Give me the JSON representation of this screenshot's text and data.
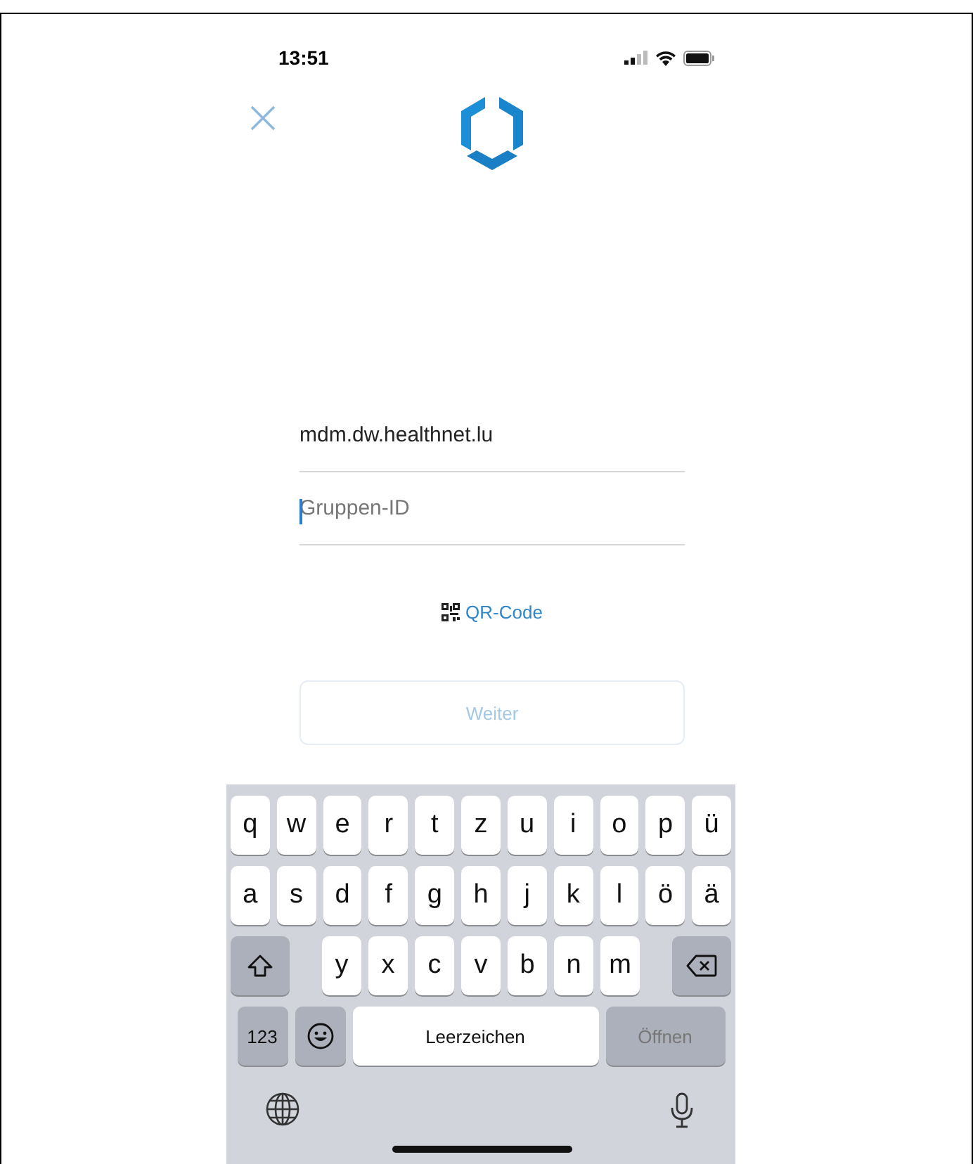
{
  "status_bar": {
    "time": "13:51"
  },
  "fields": [
    {
      "value": "mdm.dw.healthnet.lu",
      "focused": false
    },
    {
      "placeholder": "Gruppen-ID",
      "focused": true
    }
  ],
  "qr_link": {
    "label": "QR-Code"
  },
  "continue_button": {
    "label": "Weiter",
    "disabled": true
  },
  "keyboard": {
    "rows": [
      {
        "keys": [
          {
            "kind": "letter",
            "label": "q"
          },
          {
            "kind": "letter",
            "label": "w"
          },
          {
            "kind": "letter",
            "label": "e"
          },
          {
            "kind": "letter",
            "label": "r"
          },
          {
            "kind": "letter",
            "label": "t"
          },
          {
            "kind": "letter",
            "label": "z"
          },
          {
            "kind": "letter",
            "label": "u"
          },
          {
            "kind": "letter",
            "label": "i"
          },
          {
            "kind": "letter",
            "label": "o"
          },
          {
            "kind": "letter",
            "label": "p"
          },
          {
            "kind": "letter",
            "label": "ü"
          }
        ]
      },
      {
        "keys": [
          {
            "kind": "letter",
            "label": "a"
          },
          {
            "kind": "letter",
            "label": "s"
          },
          {
            "kind": "letter",
            "label": "d"
          },
          {
            "kind": "letter",
            "label": "f"
          },
          {
            "kind": "letter",
            "label": "g"
          },
          {
            "kind": "letter",
            "label": "h"
          },
          {
            "kind": "letter",
            "label": "j"
          },
          {
            "kind": "letter",
            "label": "k"
          },
          {
            "kind": "letter",
            "label": "l"
          },
          {
            "kind": "letter",
            "label": "ö"
          },
          {
            "kind": "letter",
            "label": "ä"
          }
        ]
      },
      {
        "keys": [
          {
            "kind": "shift"
          },
          {
            "kind": "letter",
            "label": "y"
          },
          {
            "kind": "letter",
            "label": "x"
          },
          {
            "kind": "letter",
            "label": "c"
          },
          {
            "kind": "letter",
            "label": "v"
          },
          {
            "kind": "letter",
            "label": "b"
          },
          {
            "kind": "letter",
            "label": "n"
          },
          {
            "kind": "letter",
            "label": "m"
          },
          {
            "kind": "delete"
          }
        ]
      },
      {
        "keys": [
          {
            "kind": "numbers",
            "label": "123"
          },
          {
            "kind": "emoji"
          },
          {
            "kind": "space",
            "label": "Leerzeichen"
          },
          {
            "kind": "return",
            "label": "Öffnen",
            "disabled": true
          }
        ]
      }
    ]
  }
}
